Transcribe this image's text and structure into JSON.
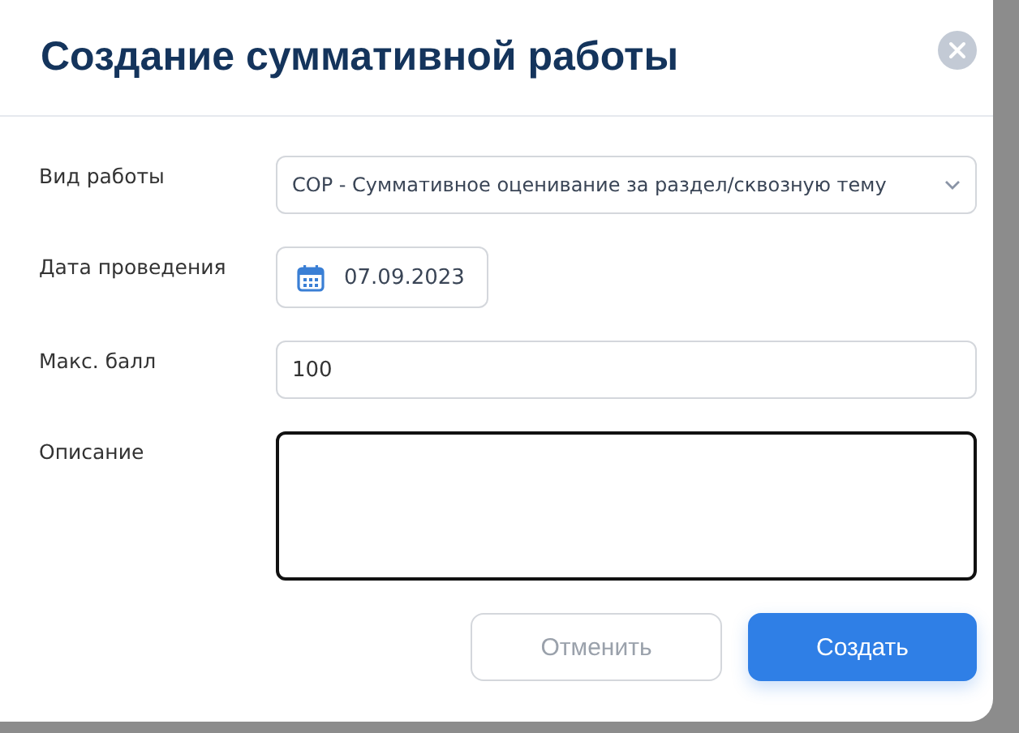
{
  "dialog": {
    "title": "Создание суммативной работы",
    "fields": [
      {
        "kind": "select",
        "label": "Вид работы",
        "value": "СОР - Суммативное оценивание за раздел/сквозную тему"
      },
      {
        "kind": "date",
        "label": "Дата проведения",
        "value": "07.09.2023"
      },
      {
        "kind": "text",
        "label": "Макс. балл",
        "value": "100"
      },
      {
        "kind": "textarea",
        "label": "Описание",
        "focused": true
      }
    ],
    "buttons": [
      {
        "label": "Отменить",
        "primary": false,
        "disabled": true
      },
      {
        "label": "Создать",
        "primary": true,
        "disabled": false
      }
    ]
  }
}
